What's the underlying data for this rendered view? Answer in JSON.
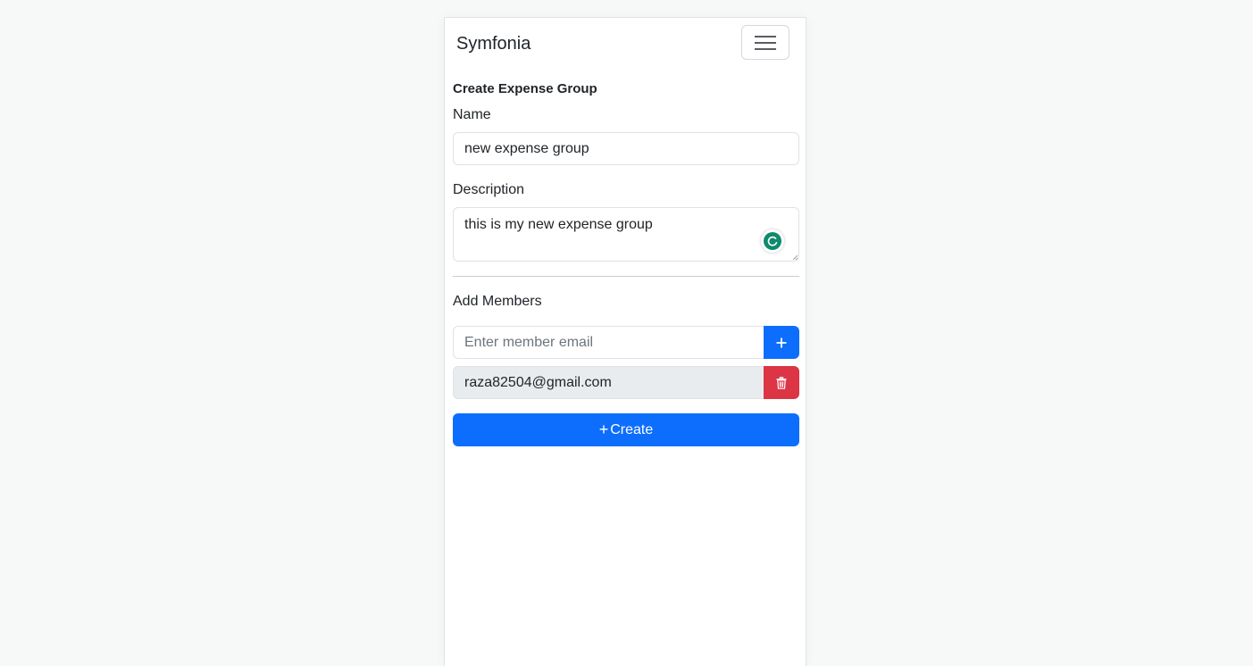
{
  "app": {
    "brand": "Symfonia"
  },
  "form": {
    "heading": "Create Expense Group",
    "name_label": "Name",
    "name_value": "new expense group",
    "description_label": "Description",
    "description_value": "this is my new expense group",
    "members_label": "Add Members",
    "member_email_placeholder": "Enter member email",
    "members": [
      "raza82504@gmail.com"
    ],
    "create_plus": "+",
    "create_label": "Create"
  },
  "icons": {
    "menu": "hamburger-icon",
    "add": "plus-icon",
    "delete": "trash-icon",
    "grammar": "grammarly-icon"
  },
  "colors": {
    "primary": "#0d6efd",
    "danger": "#dc3545",
    "readonly_bg": "#e9ecef",
    "grammar": "#0f8a6c"
  }
}
